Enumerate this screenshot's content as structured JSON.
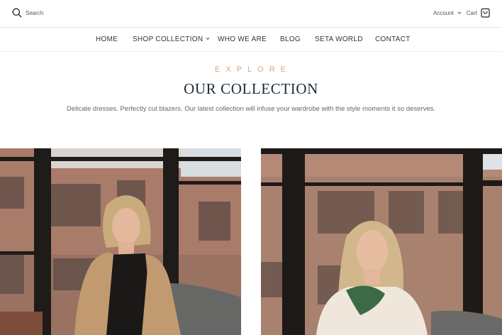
{
  "header": {
    "search_label": "Search",
    "account_label": "Account",
    "cart_label": "Cart",
    "icons": {
      "search": "search-icon",
      "chevron": "chevron-down-icon",
      "cart": "shopping-bag-icon"
    }
  },
  "nav": {
    "items": [
      {
        "label": "HOME"
      },
      {
        "label": "SHOP COLLECTION"
      },
      {
        "label": "WHO WE ARE"
      },
      {
        "label": "BLOG"
      },
      {
        "label": "SETA WORLD"
      },
      {
        "label": "CONTACT"
      }
    ]
  },
  "hero": {
    "eyebrow": "EXPLORE",
    "title": "OUR COLLECTION",
    "subtitle": "Delicate dresses. Perfectly cut blazers. Our latest collection will infuse your wardrobe with the style moments it so deserves."
  },
  "colors": {
    "accent": "#d8a487",
    "title": "#1c2d3d",
    "text": "#333333",
    "muted": "#666666",
    "divider": "#e6e6e6"
  }
}
